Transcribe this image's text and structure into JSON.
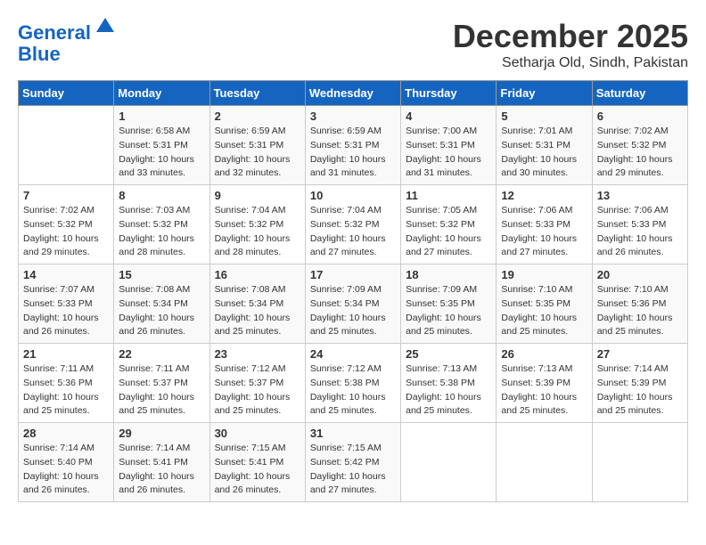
{
  "logo": {
    "line1": "General",
    "line2": "Blue"
  },
  "title": "December 2025",
  "location": "Setharja Old, Sindh, Pakistan",
  "weekdays": [
    "Sunday",
    "Monday",
    "Tuesday",
    "Wednesday",
    "Thursday",
    "Friday",
    "Saturday"
  ],
  "weeks": [
    [
      {
        "day": "",
        "sunrise": "",
        "sunset": "",
        "daylight": ""
      },
      {
        "day": "1",
        "sunrise": "Sunrise: 6:58 AM",
        "sunset": "Sunset: 5:31 PM",
        "daylight": "Daylight: 10 hours and 33 minutes."
      },
      {
        "day": "2",
        "sunrise": "Sunrise: 6:59 AM",
        "sunset": "Sunset: 5:31 PM",
        "daylight": "Daylight: 10 hours and 32 minutes."
      },
      {
        "day": "3",
        "sunrise": "Sunrise: 6:59 AM",
        "sunset": "Sunset: 5:31 PM",
        "daylight": "Daylight: 10 hours and 31 minutes."
      },
      {
        "day": "4",
        "sunrise": "Sunrise: 7:00 AM",
        "sunset": "Sunset: 5:31 PM",
        "daylight": "Daylight: 10 hours and 31 minutes."
      },
      {
        "day": "5",
        "sunrise": "Sunrise: 7:01 AM",
        "sunset": "Sunset: 5:31 PM",
        "daylight": "Daylight: 10 hours and 30 minutes."
      },
      {
        "day": "6",
        "sunrise": "Sunrise: 7:02 AM",
        "sunset": "Sunset: 5:32 PM",
        "daylight": "Daylight: 10 hours and 29 minutes."
      }
    ],
    [
      {
        "day": "7",
        "sunrise": "Sunrise: 7:02 AM",
        "sunset": "Sunset: 5:32 PM",
        "daylight": "Daylight: 10 hours and 29 minutes."
      },
      {
        "day": "8",
        "sunrise": "Sunrise: 7:03 AM",
        "sunset": "Sunset: 5:32 PM",
        "daylight": "Daylight: 10 hours and 28 minutes."
      },
      {
        "day": "9",
        "sunrise": "Sunrise: 7:04 AM",
        "sunset": "Sunset: 5:32 PM",
        "daylight": "Daylight: 10 hours and 28 minutes."
      },
      {
        "day": "10",
        "sunrise": "Sunrise: 7:04 AM",
        "sunset": "Sunset: 5:32 PM",
        "daylight": "Daylight: 10 hours and 27 minutes."
      },
      {
        "day": "11",
        "sunrise": "Sunrise: 7:05 AM",
        "sunset": "Sunset: 5:32 PM",
        "daylight": "Daylight: 10 hours and 27 minutes."
      },
      {
        "day": "12",
        "sunrise": "Sunrise: 7:06 AM",
        "sunset": "Sunset: 5:33 PM",
        "daylight": "Daylight: 10 hours and 27 minutes."
      },
      {
        "day": "13",
        "sunrise": "Sunrise: 7:06 AM",
        "sunset": "Sunset: 5:33 PM",
        "daylight": "Daylight: 10 hours and 26 minutes."
      }
    ],
    [
      {
        "day": "14",
        "sunrise": "Sunrise: 7:07 AM",
        "sunset": "Sunset: 5:33 PM",
        "daylight": "Daylight: 10 hours and 26 minutes."
      },
      {
        "day": "15",
        "sunrise": "Sunrise: 7:08 AM",
        "sunset": "Sunset: 5:34 PM",
        "daylight": "Daylight: 10 hours and 26 minutes."
      },
      {
        "day": "16",
        "sunrise": "Sunrise: 7:08 AM",
        "sunset": "Sunset: 5:34 PM",
        "daylight": "Daylight: 10 hours and 25 minutes."
      },
      {
        "day": "17",
        "sunrise": "Sunrise: 7:09 AM",
        "sunset": "Sunset: 5:34 PM",
        "daylight": "Daylight: 10 hours and 25 minutes."
      },
      {
        "day": "18",
        "sunrise": "Sunrise: 7:09 AM",
        "sunset": "Sunset: 5:35 PM",
        "daylight": "Daylight: 10 hours and 25 minutes."
      },
      {
        "day": "19",
        "sunrise": "Sunrise: 7:10 AM",
        "sunset": "Sunset: 5:35 PM",
        "daylight": "Daylight: 10 hours and 25 minutes."
      },
      {
        "day": "20",
        "sunrise": "Sunrise: 7:10 AM",
        "sunset": "Sunset: 5:36 PM",
        "daylight": "Daylight: 10 hours and 25 minutes."
      }
    ],
    [
      {
        "day": "21",
        "sunrise": "Sunrise: 7:11 AM",
        "sunset": "Sunset: 5:36 PM",
        "daylight": "Daylight: 10 hours and 25 minutes."
      },
      {
        "day": "22",
        "sunrise": "Sunrise: 7:11 AM",
        "sunset": "Sunset: 5:37 PM",
        "daylight": "Daylight: 10 hours and 25 minutes."
      },
      {
        "day": "23",
        "sunrise": "Sunrise: 7:12 AM",
        "sunset": "Sunset: 5:37 PM",
        "daylight": "Daylight: 10 hours and 25 minutes."
      },
      {
        "day": "24",
        "sunrise": "Sunrise: 7:12 AM",
        "sunset": "Sunset: 5:38 PM",
        "daylight": "Daylight: 10 hours and 25 minutes."
      },
      {
        "day": "25",
        "sunrise": "Sunrise: 7:13 AM",
        "sunset": "Sunset: 5:38 PM",
        "daylight": "Daylight: 10 hours and 25 minutes."
      },
      {
        "day": "26",
        "sunrise": "Sunrise: 7:13 AM",
        "sunset": "Sunset: 5:39 PM",
        "daylight": "Daylight: 10 hours and 25 minutes."
      },
      {
        "day": "27",
        "sunrise": "Sunrise: 7:14 AM",
        "sunset": "Sunset: 5:39 PM",
        "daylight": "Daylight: 10 hours and 25 minutes."
      }
    ],
    [
      {
        "day": "28",
        "sunrise": "Sunrise: 7:14 AM",
        "sunset": "Sunset: 5:40 PM",
        "daylight": "Daylight: 10 hours and 26 minutes."
      },
      {
        "day": "29",
        "sunrise": "Sunrise: 7:14 AM",
        "sunset": "Sunset: 5:41 PM",
        "daylight": "Daylight: 10 hours and 26 minutes."
      },
      {
        "day": "30",
        "sunrise": "Sunrise: 7:15 AM",
        "sunset": "Sunset: 5:41 PM",
        "daylight": "Daylight: 10 hours and 26 minutes."
      },
      {
        "day": "31",
        "sunrise": "Sunrise: 7:15 AM",
        "sunset": "Sunset: 5:42 PM",
        "daylight": "Daylight: 10 hours and 27 minutes."
      },
      {
        "day": "",
        "sunrise": "",
        "sunset": "",
        "daylight": ""
      },
      {
        "day": "",
        "sunrise": "",
        "sunset": "",
        "daylight": ""
      },
      {
        "day": "",
        "sunrise": "",
        "sunset": "",
        "daylight": ""
      }
    ]
  ]
}
